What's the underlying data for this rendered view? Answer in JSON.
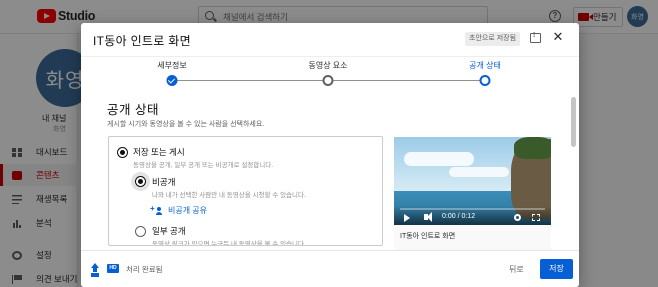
{
  "header": {
    "logo_text": "Studio",
    "search_placeholder": "채널에서 검색하기",
    "create_label": "만들기",
    "avatar_text": "화영"
  },
  "sidebar": {
    "avatar_text": "화영",
    "channel_label": "내 채널",
    "channel_handle": "화영",
    "items": [
      {
        "label": "대시보드",
        "icon": "dashboard-icon"
      },
      {
        "label": "콘텐츠",
        "icon": "content-icon",
        "active": true
      },
      {
        "label": "재생목록",
        "icon": "playlist-icon"
      },
      {
        "label": "분석",
        "icon": "analytics-icon"
      },
      {
        "label": "설정",
        "icon": "settings-icon"
      },
      {
        "label": "의견 보내기",
        "icon": "feedback-icon"
      }
    ]
  },
  "dialog": {
    "title": "IT동아 인트로 화면",
    "saved_badge": "초안으로 저장됨",
    "steps": [
      {
        "label": "세부정보",
        "state": "done"
      },
      {
        "label": "동영상 요소",
        "state": "todo"
      },
      {
        "label": "공개 상태",
        "state": "current"
      }
    ],
    "section_title": "공개 상태",
    "section_subtitle": "게시할 시기와 동영상을 볼 수 있는 사람을 선택하세요.",
    "options": {
      "save_publish": {
        "label": "저장 또는 게시",
        "desc": "동영상을 공개, 일부 공개 또는 비공개로 설정합니다."
      },
      "private": {
        "label": "비공개",
        "desc": "나와 내가 선택한 사람만 내 동영상을 시청할 수 있습니다."
      },
      "share_private_label": "비공개 공유",
      "unlisted": {
        "label": "일부 공개",
        "desc": "동영상 링크가 있으면 누구든 내 동영상을 볼 수 있습니다."
      }
    },
    "preview": {
      "time": "0:00 / 0:12",
      "title": "IT동아 인트로 화면"
    },
    "footer": {
      "status": "처리 완료됨",
      "hd_badge": "HD",
      "back_label": "뒤로",
      "save_label": "저장"
    }
  },
  "colors": {
    "accent": "#065fd4",
    "brand_red": "#ff0000",
    "avatar": "#3d6c9c"
  }
}
